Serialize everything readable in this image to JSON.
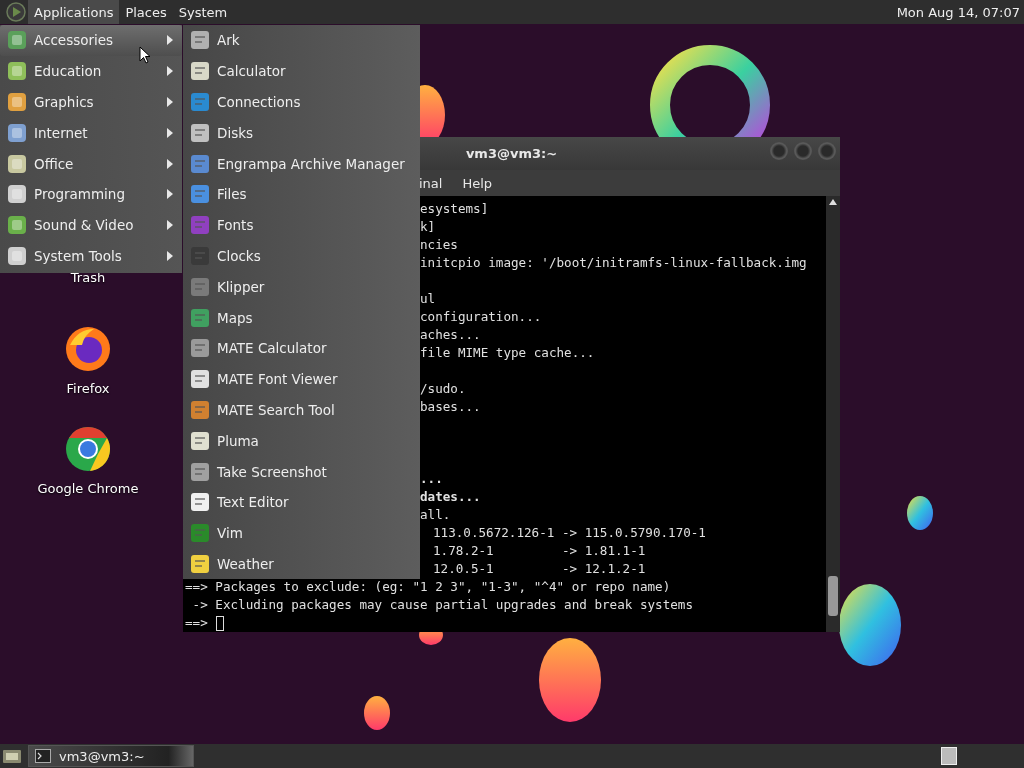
{
  "top_panel": {
    "menus": [
      {
        "label": "Applications",
        "selected": true
      },
      {
        "label": "Places",
        "selected": false
      },
      {
        "label": "System",
        "selected": false
      }
    ],
    "clock": "Mon Aug 14, 07:07"
  },
  "applications_menu": {
    "categories": [
      {
        "label": "Accessories",
        "selected": true
      },
      {
        "label": "Education",
        "selected": false
      },
      {
        "label": "Graphics",
        "selected": false
      },
      {
        "label": "Internet",
        "selected": false
      },
      {
        "label": "Office",
        "selected": false
      },
      {
        "label": "Programming",
        "selected": false
      },
      {
        "label": "Sound & Video",
        "selected": false
      },
      {
        "label": "System Tools",
        "selected": false
      }
    ],
    "submenu_items": [
      "Ark",
      "Calculator",
      "Connections",
      "Disks",
      "Engrampa Archive Manager",
      "Files",
      "Fonts",
      "Clocks",
      "Klipper",
      "Maps",
      "MATE Calculator",
      "MATE Font Viewer",
      "MATE Search Tool",
      "Pluma",
      "Take Screenshot",
      "Text Editor",
      "Vim",
      "Weather"
    ]
  },
  "desktop_icons": [
    {
      "kind": "trash",
      "label": "Trash"
    },
    {
      "kind": "firefox",
      "label": "Firefox"
    },
    {
      "kind": "chrome",
      "label": "Google Chrome"
    }
  ],
  "terminal": {
    "title": "vm3@vm3:~",
    "menus": [
      "inal",
      "Help"
    ],
    "lines": [
      {
        "kind": "covered",
        "text": "esystems]",
        "bold": false
      },
      {
        "kind": "covered",
        "text": "k]",
        "bold": false
      },
      {
        "kind": "covered",
        "text": "ncies",
        "bold": false
      },
      {
        "kind": "covered",
        "text": "initcpio image: '/boot/initramfs-linux-fallback.img",
        "bold": false
      },
      {
        "kind": "blank"
      },
      {
        "kind": "covered",
        "text": "ul",
        "bold": false
      },
      {
        "kind": "covered",
        "text": "configuration...",
        "bold": false
      },
      {
        "kind": "covered",
        "text": "aches...",
        "bold": false
      },
      {
        "kind": "covered",
        "text": "file MIME type cache...",
        "bold": false
      },
      {
        "kind": "blank"
      },
      {
        "kind": "covered",
        "text": "/sudo.",
        "bold": false
      },
      {
        "kind": "covered",
        "text": "bases...",
        "bold": false
      },
      {
        "kind": "blank"
      },
      {
        "kind": "blank"
      },
      {
        "kind": "blank"
      },
      {
        "kind": "covered",
        "text": "...",
        "bold": true
      },
      {
        "kind": "covered",
        "text": "dates...",
        "bold": true
      },
      {
        "kind": "covered",
        "text": "all.",
        "bold": false
      },
      {
        "kind": "table",
        "text": "113.0.5672.126-1 -> 115.0.5790.170-1",
        "bold": false
      },
      {
        "kind": "table",
        "text": "1.78.2-1         -> 1.81.1-1",
        "bold": false
      },
      {
        "kind": "table",
        "text": "12.0.5-1         -> 12.1.2-1",
        "bold": false
      },
      {
        "kind": "full",
        "text": "==> Packages to exclude: (eg: \"1 2 3\", \"1-3\", \"^4\" or repo name)",
        "bold": false
      },
      {
        "kind": "full",
        "text": " -> Excluding packages may cause partial upgrades and break systems",
        "bold": false
      },
      {
        "kind": "prompt",
        "text": "==>",
        "bold": false
      }
    ]
  },
  "taskbar": {
    "tasks": [
      {
        "label": "vm3@vm3:~"
      }
    ]
  }
}
